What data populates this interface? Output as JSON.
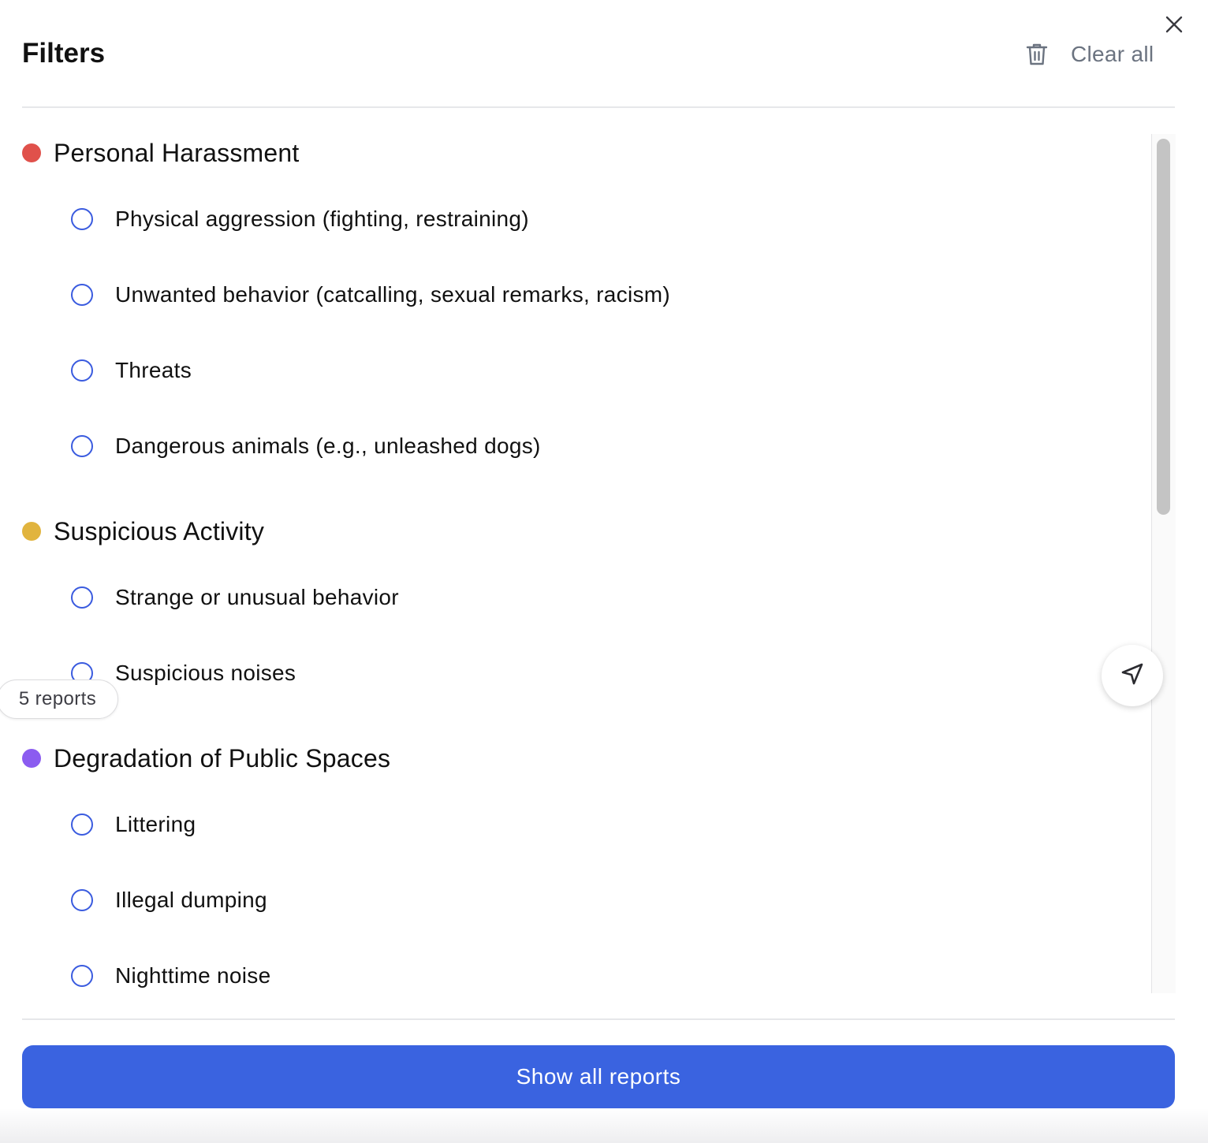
{
  "header": {
    "title": "Filters",
    "clear_all_label": "Clear all",
    "close_icon": "close-icon",
    "clear_icon": "trash-icon"
  },
  "categories": [
    {
      "label": "Personal Harassment",
      "color": "#e0514b",
      "options": [
        "Physical aggression (fighting, restraining)",
        "Unwanted behavior (catcalling, sexual remarks, racism)",
        "Threats",
        "Dangerous animals (e.g., unleashed dogs)"
      ]
    },
    {
      "label": "Suspicious Activity",
      "color": "#e1b43e",
      "options": [
        "Strange or unusual behavior",
        "Suspicious noises"
      ]
    },
    {
      "label": "Degradation of Public Spaces",
      "color": "#8b5cf0",
      "options": [
        "Littering",
        "Illegal dumping",
        "Nighttime noise"
      ]
    }
  ],
  "floating": {
    "reports_count_label": "5 reports",
    "locate_icon": "navigation-arrow-icon"
  },
  "footer": {
    "show_all_label": "Show all reports",
    "button_color": "#3a63e0"
  },
  "colors": {
    "radio_border": "#3a5bdf",
    "muted_text": "#6b7380"
  }
}
